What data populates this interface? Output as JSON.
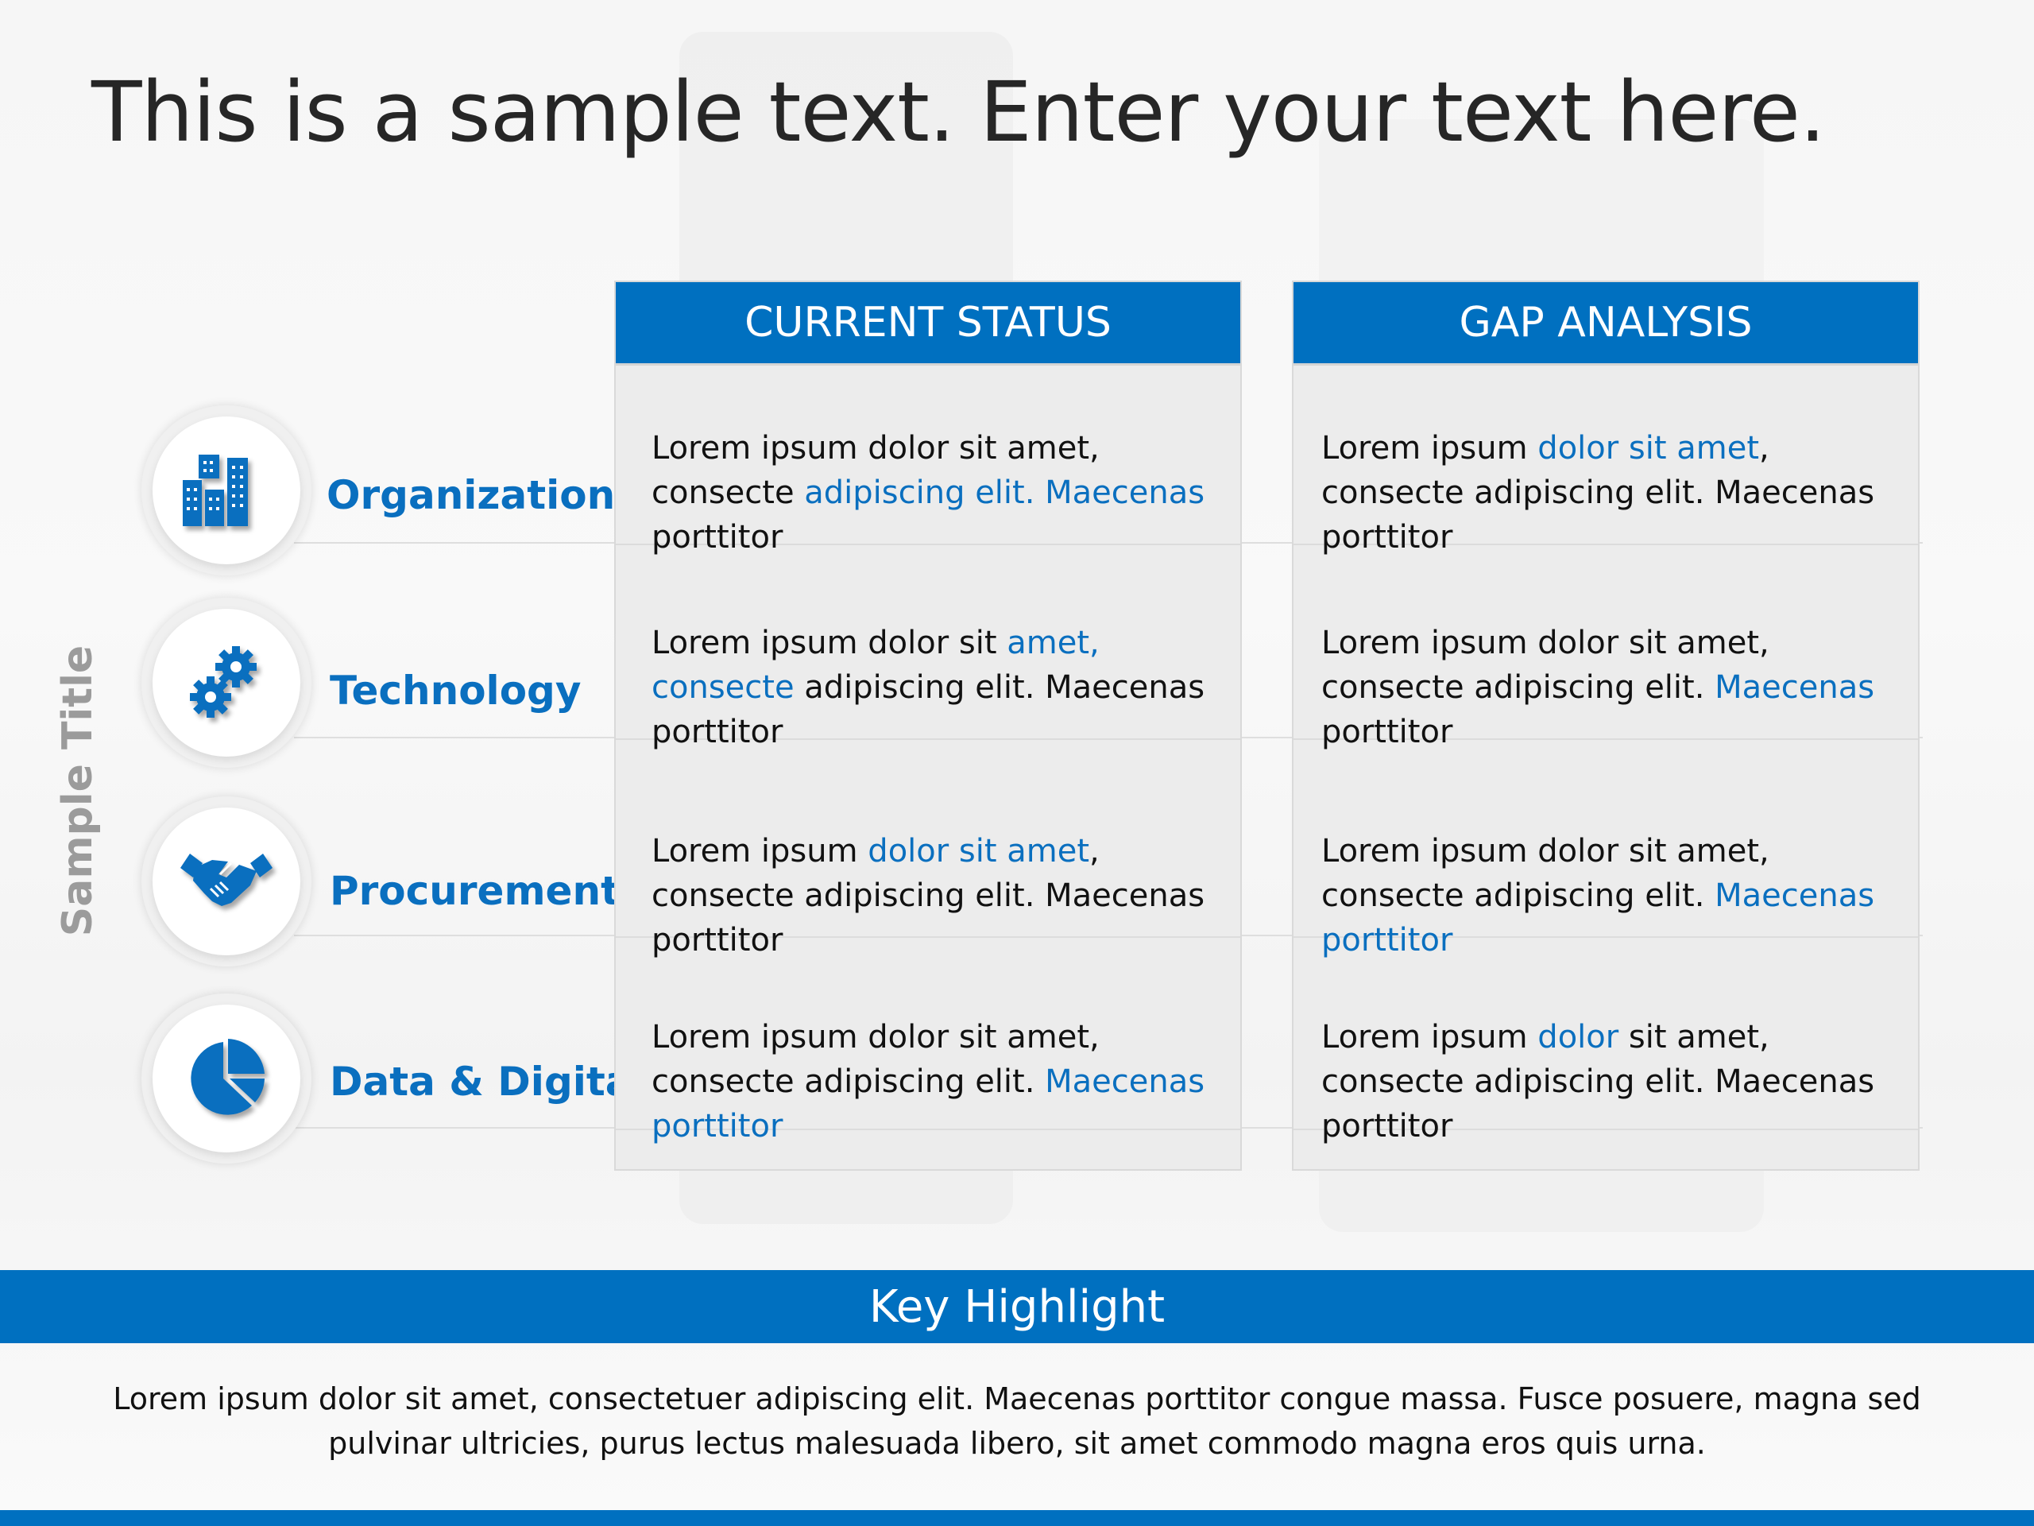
{
  "title": "This is a sample text. Enter your text here.",
  "side_title": "Sample Title",
  "categories": [
    {
      "label": "Organization",
      "icon": "buildings-icon"
    },
    {
      "label": "Technology",
      "icon": "gears-icon"
    },
    {
      "label": "Procurement",
      "icon": "handshake-icon"
    },
    {
      "label": "Data & Digital",
      "icon": "pie-chart-icon"
    }
  ],
  "columns": {
    "current": {
      "header": "CURRENT STATUS",
      "cells": [
        [
          {
            "t": "Lorem ipsum dolor sit amet, consecte ",
            "h": false
          },
          {
            "t": "adipiscing elit. Maecenas",
            "h": true
          },
          {
            "t": " porttitor",
            "h": false
          }
        ],
        [
          {
            "t": "Lorem ipsum dolor sit ",
            "h": false
          },
          {
            "t": "amet, consecte",
            "h": true
          },
          {
            "t": " adipiscing elit. Maecenas porttitor",
            "h": false
          }
        ],
        [
          {
            "t": "Lorem ipsum ",
            "h": false
          },
          {
            "t": "dolor sit amet",
            "h": true
          },
          {
            "t": ", consecte adipiscing elit. Maecenas porttitor",
            "h": false
          }
        ],
        [
          {
            "t": "Lorem ipsum dolor sit amet, consecte adipiscing elit. ",
            "h": false
          },
          {
            "t": "Maecenas porttitor",
            "h": true
          }
        ]
      ]
    },
    "gap": {
      "header": "GAP ANALYSIS",
      "cells": [
        [
          {
            "t": "Lorem ipsum ",
            "h": false
          },
          {
            "t": "dolor sit amet",
            "h": true
          },
          {
            "t": ", consecte adipiscing elit. Maecenas porttitor",
            "h": false
          }
        ],
        [
          {
            "t": "Lorem ipsum dolor sit amet, consecte adipiscing elit. ",
            "h": false
          },
          {
            "t": "Maecenas",
            "h": true
          },
          {
            "t": " porttitor",
            "h": false
          }
        ],
        [
          {
            "t": "Lorem ipsum dolor sit amet, consecte adipiscing elit. ",
            "h": false
          },
          {
            "t": "Maecenas porttitor",
            "h": true
          }
        ],
        [
          {
            "t": "Lorem ipsum ",
            "h": false
          },
          {
            "t": "dolor",
            "h": true
          },
          {
            "t": " sit amet, consecte adipiscing elit. Maecenas porttitor",
            "h": false
          }
        ]
      ]
    }
  },
  "key_highlight": {
    "title": "Key Highlight",
    "body": "Lorem ipsum dolor sit amet, consectetuer adipiscing elit. Maecenas porttitor congue massa. Fusce posuere, magna sed pulvinar ultricies, purus lectus malesuada libero, sit amet commodo magna eros quis urna."
  },
  "colors": {
    "accent": "#0070c0",
    "highlight_text": "#0a6fbf",
    "cell_bg": "#ececec"
  }
}
